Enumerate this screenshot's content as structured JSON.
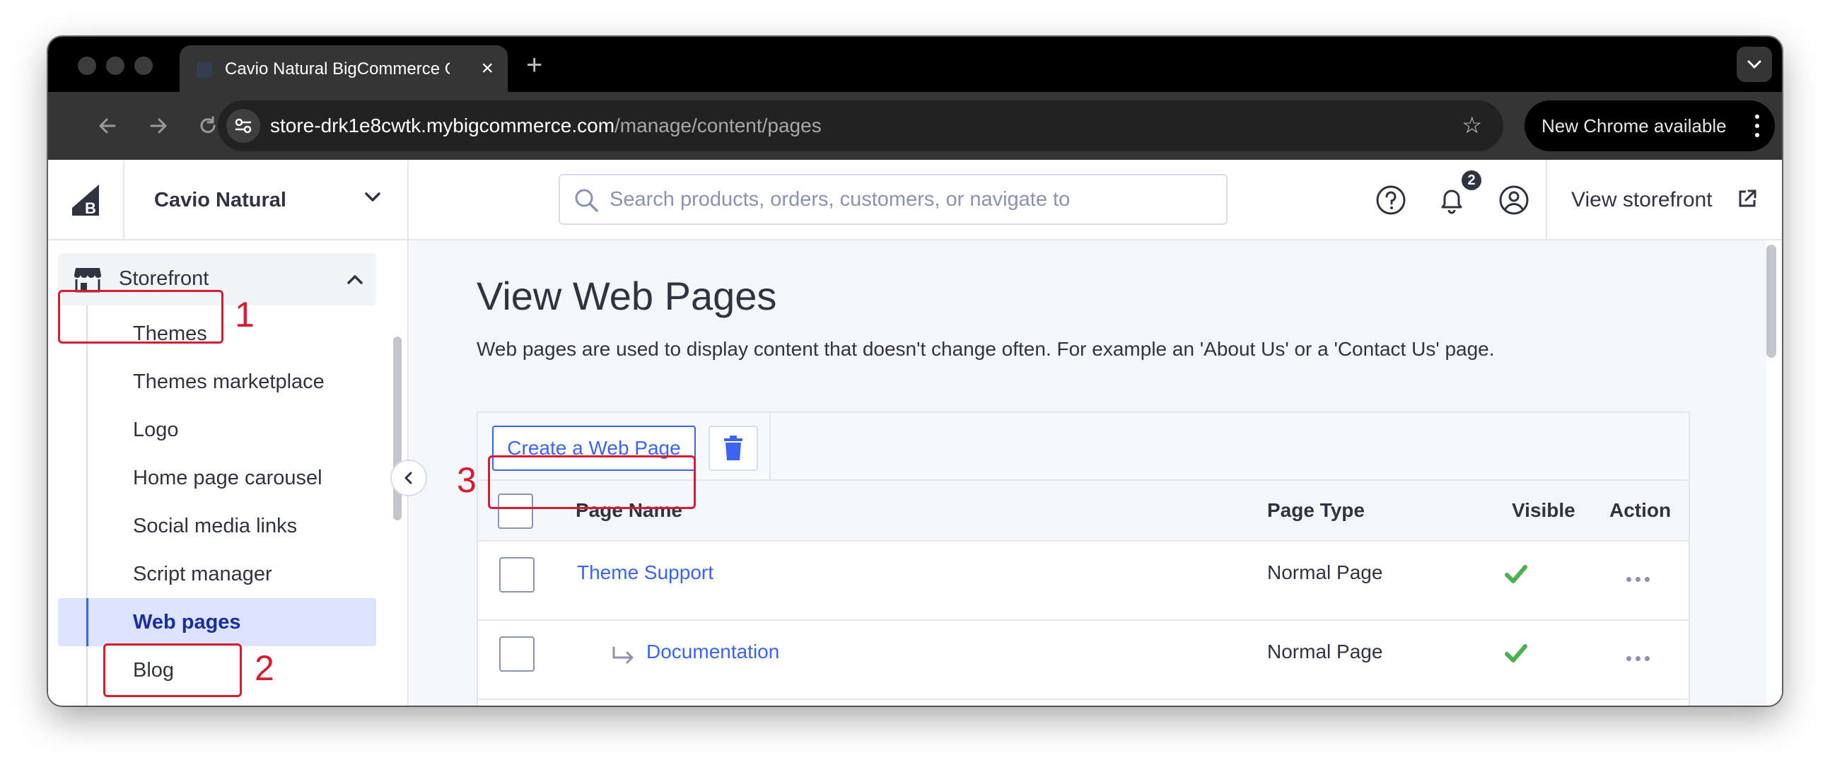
{
  "browser": {
    "tab_title": "Cavio Natural BigCommerce Co",
    "new_tab_glyph": "+",
    "url_host": "store-drk1e8cwtk.mybigcommerce.com",
    "url_path": "/manage/content/pages",
    "update_label": "New Chrome available",
    "icons": [
      "back-arrow-icon",
      "forward-arrow-icon",
      "reload-icon",
      "site-info-icon",
      "bookmark-star-icon",
      "more-vert-icon",
      "tab-search-chevron-icon"
    ]
  },
  "header": {
    "store_name": "Cavio Natural",
    "search_placeholder": "Search products, orders, customers, or navigate to",
    "notification_count": "2",
    "view_storefront_label": "View storefront",
    "icons": [
      "bigcommerce-logo-icon",
      "chevron-down-icon",
      "search-icon",
      "help-icon",
      "bell-icon",
      "account-icon",
      "external-link-icon"
    ]
  },
  "sidebar": {
    "section_label": "Storefront",
    "items": [
      {
        "label": "Themes"
      },
      {
        "label": "Themes marketplace"
      },
      {
        "label": "Logo"
      },
      {
        "label": "Home page carousel"
      },
      {
        "label": "Social media links"
      },
      {
        "label": "Script manager"
      },
      {
        "label": "Web pages",
        "active": true
      },
      {
        "label": "Blog"
      }
    ]
  },
  "main": {
    "title": "View Web Pages",
    "description": "Web pages are used to display content that doesn't change often. For example an 'About Us' or a 'Contact Us' page.",
    "create_button_label": "Create a Web Page",
    "table": {
      "columns": [
        "Page Name",
        "Page Type",
        "Visible",
        "Action"
      ],
      "rows": [
        {
          "name": "Theme Support",
          "type": "Normal Page",
          "visible": true,
          "child": false
        },
        {
          "name": "Documentation",
          "type": "Normal Page",
          "visible": true,
          "child": true
        }
      ]
    }
  },
  "annotations": {
    "color": "#d41d35",
    "labels": [
      "1",
      "2",
      "3"
    ]
  },
  "colors": {
    "accent": "#3c64f4",
    "active_bg": "#dbe3fe",
    "active_text": "#1c2da0",
    "visible_check": "#4caf50"
  }
}
